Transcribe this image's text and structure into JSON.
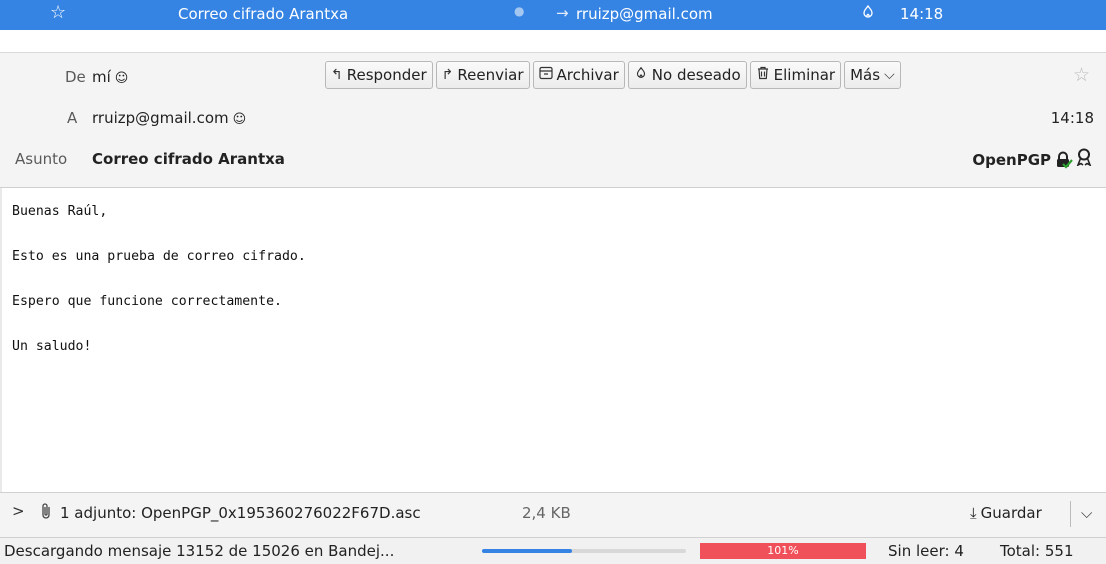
{
  "thread_row": {
    "subject": "Correo cifrado Arantxa",
    "recipient": "rruizp@gmail.com",
    "time": "14:18",
    "arrow": "→"
  },
  "header": {
    "from_label": "De",
    "from_value": "mí",
    "to_label": "A",
    "to_value": "rruizp@gmail.com",
    "subject_label": "Asunto",
    "subject_value": "Correo cifrado Arantxa",
    "date": "14:18",
    "security_label": "OpenPGP",
    "toolbar": {
      "reply": "Responder",
      "forward": "Reenviar",
      "archive": "Archivar",
      "junk": "No deseado",
      "delete": "Eliminar",
      "more": "Más"
    }
  },
  "message": {
    "lines": [
      "Buenas Raúl,",
      "Esto es una prueba de correo cifrado.",
      "Espero que funcione correctamente.",
      "Un saludo!"
    ]
  },
  "attachment": {
    "summary": "1 adjunto: OpenPGP_0x195360276022F67D.asc",
    "size": "2,4 KB",
    "save_label": "Guardar"
  },
  "status": {
    "activity": "Descargando mensaje 13152 de 15026 en Bandej...",
    "download_progress": 0.44,
    "quota_label": "101%",
    "unread": "Sin leer: 4",
    "total": "Total: 551"
  },
  "colors": {
    "accent": "#3584e4",
    "quota_bar": "#f0505a",
    "verified": "#2ca02c"
  },
  "icons": [
    "star-icon",
    "junk-icon",
    "reply-icon",
    "forward-icon",
    "archive-icon",
    "trash-icon",
    "chevron-down-icon",
    "contact-card-icon",
    "lock-icon",
    "checkmark-icon",
    "certificate-icon",
    "chevron-right-icon",
    "paperclip-icon",
    "download-icon"
  ]
}
